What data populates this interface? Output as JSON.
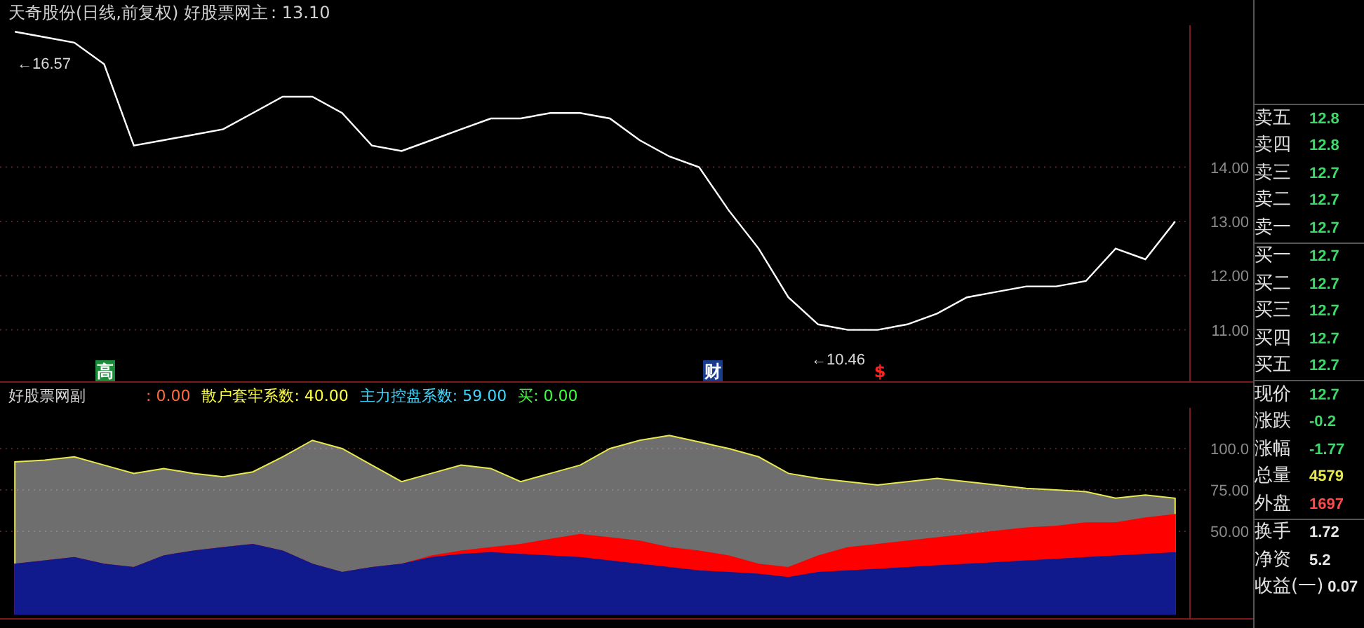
{
  "header": {
    "title": "天奇股份(日线,前复权) 好股票网主",
    "value": ": 13.10"
  },
  "main_chart": {
    "chart_data": {
      "type": "line",
      "grid": true,
      "categories": [
        null,
        null,
        null,
        null,
        null,
        null,
        null,
        null,
        null,
        null,
        null,
        null,
        null,
        null,
        null,
        null,
        null,
        null,
        null,
        null,
        null,
        null,
        null,
        null,
        null,
        null,
        null,
        null,
        null,
        null,
        null,
        null,
        null,
        null,
        null,
        null,
        null,
        null,
        null,
        null
      ],
      "ylim": [
        10.05,
        16.62
      ],
      "yticks": [
        {
          "value": 11,
          "label": "11.00"
        },
        {
          "value": 12,
          "label": "12.00"
        },
        {
          "value": 13,
          "label": "13.00"
        },
        {
          "value": 14,
          "label": "14.00"
        }
      ],
      "series": [
        {
          "color": "#ffffff",
          "values": [
            16.5,
            16.4,
            16.3,
            15.9,
            14.4,
            14.5,
            14.6,
            14.7,
            15.0,
            15.3,
            15.3,
            15.0,
            14.4,
            14.3,
            14.5,
            14.7,
            14.9,
            14.9,
            15.0,
            15.0,
            14.9,
            14.5,
            14.2,
            14.0,
            13.2,
            12.5,
            11.6,
            11.1,
            11.0,
            11.0,
            11.1,
            11.3,
            11.6,
            11.7,
            11.8,
            11.8,
            11.9,
            12.5,
            12.3,
            13.0
          ]
        }
      ]
    },
    "price_labels": [
      {
        "text": "←16.57",
        "kind": "high"
      },
      {
        "text": "←10.46",
        "kind": "low"
      }
    ],
    "markers": [
      {
        "text": "高",
        "kind": "high"
      },
      {
        "text": "财",
        "kind": "finance"
      },
      {
        "text": "$",
        "kind": "dollar"
      }
    ]
  },
  "indicator": {
    "name": "好股票网副",
    "legend": [
      {
        "text": ": 0.00",
        "color": "#ff6a3d"
      },
      {
        "text": "散户套牢系数: 40.00",
        "color": "#ffff3d"
      },
      {
        "text": "主力控盘系数: 59.00",
        "color": "#3dd7ff"
      },
      {
        "text": "买: 0.00",
        "color": "#3dff3d"
      }
    ],
    "chart_data": {
      "type": "area",
      "grid": true,
      "categories": [
        null,
        null,
        null,
        null,
        null,
        null,
        null,
        null,
        null,
        null,
        null,
        null,
        null,
        null,
        null,
        null,
        null,
        null,
        null,
        null,
        null,
        null,
        null,
        null,
        null,
        null,
        null,
        null,
        null,
        null,
        null,
        null,
        null,
        null,
        null,
        null,
        null,
        null,
        null,
        null
      ],
      "ylim": [
        -2.5,
        124.6
      ],
      "yticks": [
        {
          "value": 50,
          "label": "50.00"
        },
        {
          "value": 75,
          "label": "75.00"
        },
        {
          "value": 100,
          "label": "100.0"
        }
      ],
      "series": [
        {
          "color": "#c8c8c8",
          "values": [
            92,
            93,
            95,
            90,
            85,
            88,
            85,
            83,
            86,
            95,
            105,
            100,
            90,
            80,
            85,
            90,
            88,
            80,
            85,
            90,
            100,
            105,
            108,
            104,
            100,
            95,
            85,
            82,
            80,
            78,
            80,
            82,
            80,
            78,
            76,
            75,
            74,
            70,
            72,
            70
          ]
        },
        {
          "color": "#ff0000",
          "values": [
            30,
            32,
            34,
            30,
            28,
            35,
            38,
            40,
            42,
            38,
            30,
            25,
            28,
            30,
            35,
            38,
            40,
            42,
            45,
            48,
            46,
            44,
            40,
            38,
            35,
            30,
            28,
            35,
            40,
            42,
            44,
            46,
            48,
            50,
            52,
            53,
            55,
            55,
            58,
            60
          ]
        },
        {
          "color": "#101a8c",
          "values": [
            30,
            32,
            34,
            30,
            28,
            35,
            38,
            40,
            42,
            38,
            30,
            25,
            28,
            30,
            34,
            36,
            37,
            36,
            35,
            34,
            32,
            30,
            28,
            26,
            25,
            24,
            22,
            25,
            26,
            27,
            28,
            29,
            30,
            31,
            32,
            33,
            34,
            35,
            36,
            37
          ]
        }
      ]
    }
  },
  "quote_groups": [
    [
      {
        "label": "卖五",
        "value": "12.8",
        "color": "#3dd86a"
      },
      {
        "label": "卖四",
        "value": "12.8",
        "color": "#3dd86a"
      },
      {
        "label": "卖三",
        "value": "12.7",
        "color": "#3dd86a"
      },
      {
        "label": "卖二",
        "value": "12.7",
        "color": "#3dd86a"
      },
      {
        "label": "卖一",
        "value": "12.7",
        "color": "#3dd86a"
      }
    ],
    [
      {
        "label": "买一",
        "value": "12.7",
        "color": "#3dd86a"
      },
      {
        "label": "买二",
        "value": "12.7",
        "color": "#3dd86a"
      },
      {
        "label": "买三",
        "value": "12.7",
        "color": "#3dd86a"
      },
      {
        "label": "买四",
        "value": "12.7",
        "color": "#3dd86a"
      },
      {
        "label": "买五",
        "value": "12.7",
        "color": "#3dd86a"
      }
    ],
    [
      {
        "label": "现价",
        "value": "12.7",
        "color": "#3dd86a"
      },
      {
        "label": "涨跌",
        "value": "-0.2",
        "color": "#3dd86a"
      },
      {
        "label": "涨幅",
        "value": "-1.77",
        "color": "#3dd86a"
      },
      {
        "label": "总量",
        "value": "4579",
        "color": "#e8e84a"
      },
      {
        "label": "外盘",
        "value": "1697",
        "color": "#ff4a4a"
      }
    ],
    [
      {
        "label": "换手",
        "value": "1.72",
        "color": "#e8e8e8"
      },
      {
        "label": "净资",
        "value": "5.2",
        "color": "#e8e8e8"
      },
      {
        "label": "收益(一)",
        "value": "0.07",
        "color": "#e8e8e8"
      }
    ]
  ]
}
